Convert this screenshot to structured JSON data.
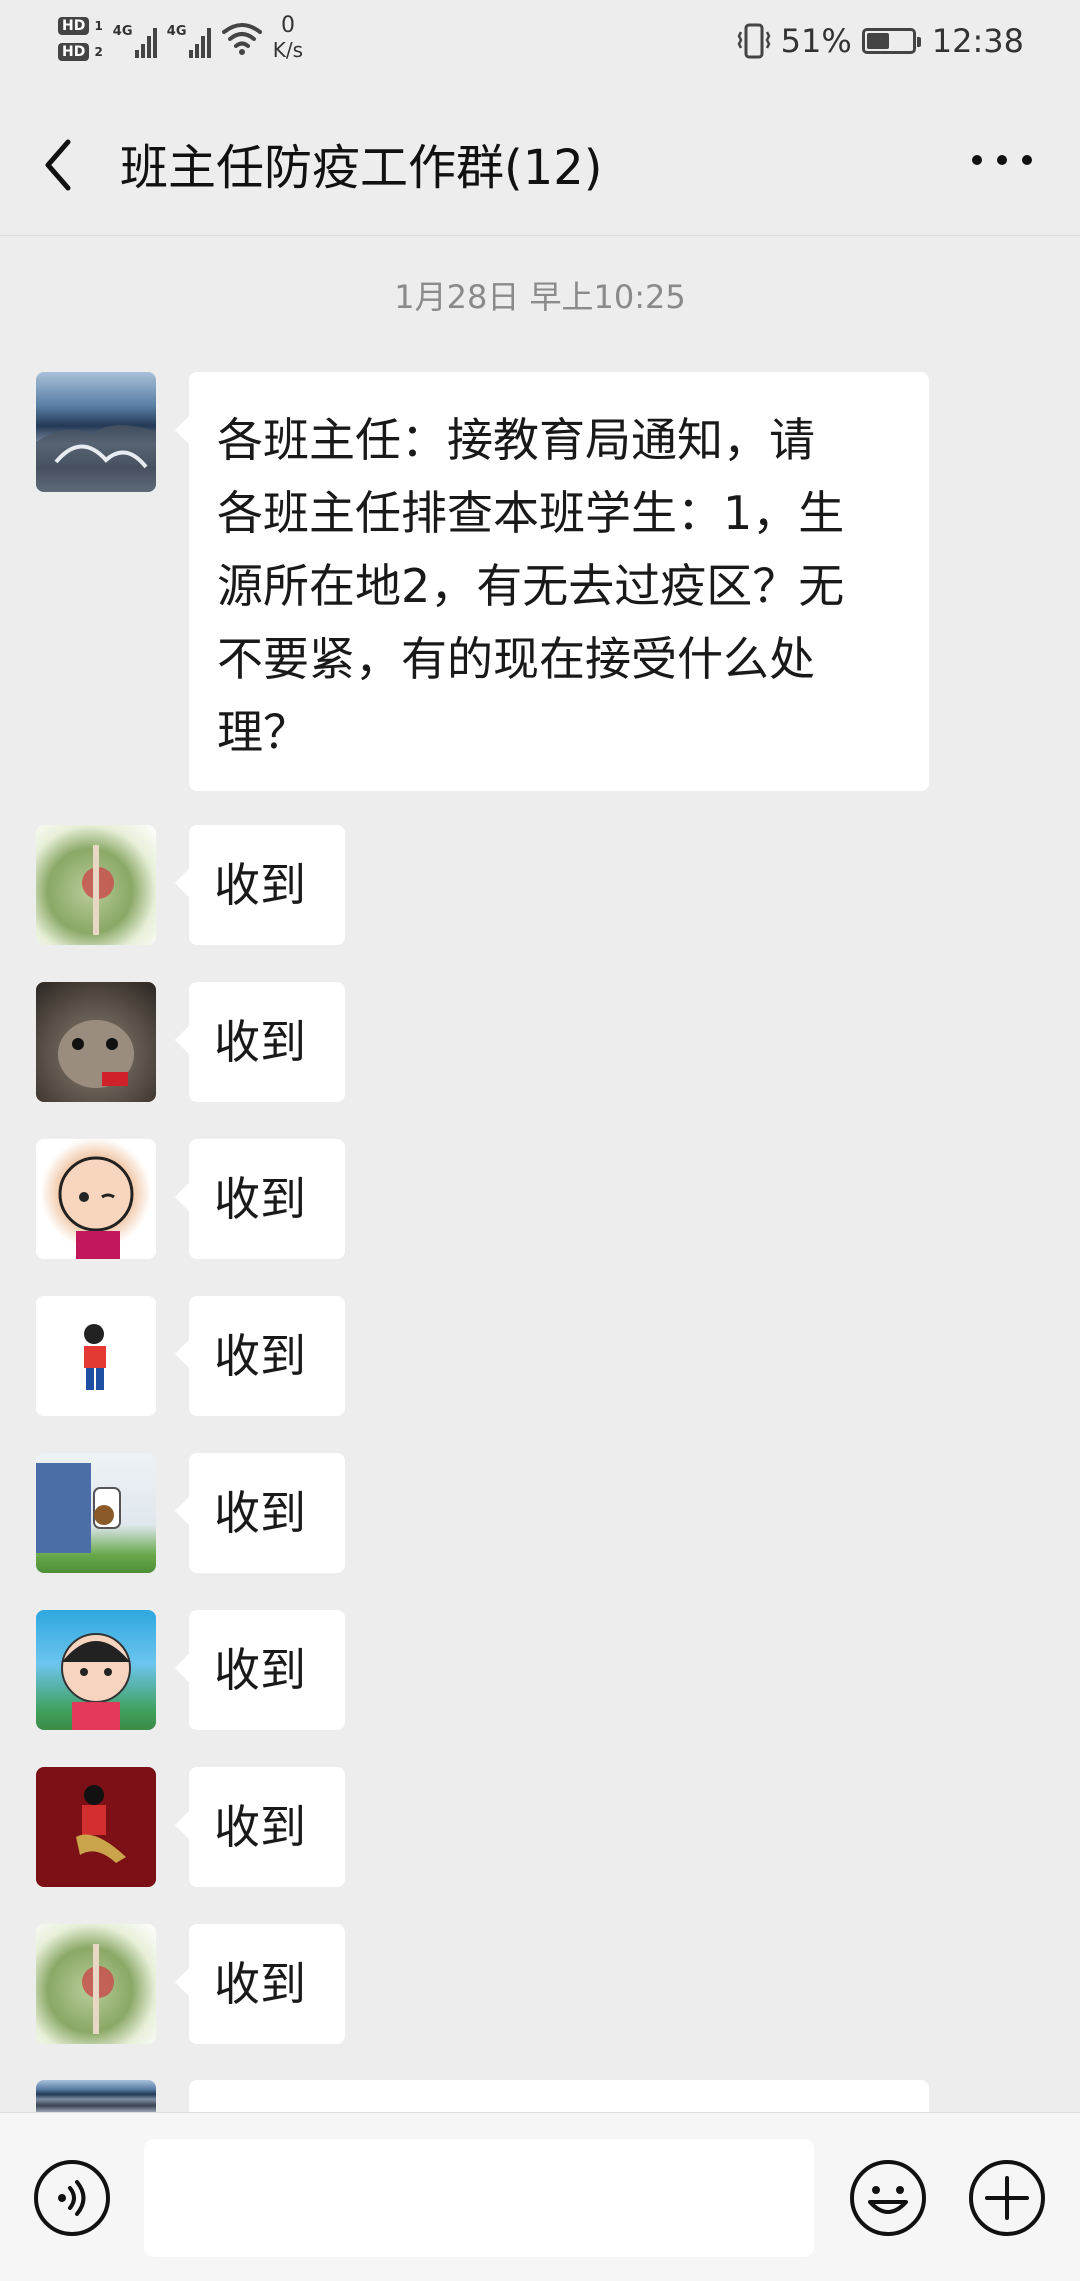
{
  "status_bar": {
    "sim1_label": "HD",
    "sim1_index": "1",
    "sim2_label": "HD",
    "sim2_index": "2",
    "network1": "4G",
    "network2": "4G",
    "speed_value": "0",
    "speed_unit": "K/s",
    "battery_percent": "51%",
    "battery_level": 0.51,
    "time": "12:38"
  },
  "header": {
    "title": "班主任防疫工作群(12)",
    "back_icon": "chevron-left-icon",
    "more_icon": "more-horizontal-icon"
  },
  "chat": {
    "timestamp": "1月28日 早上10:25",
    "messages": [
      {
        "avatar": "lake-avatar",
        "lines": [
          "各班主任：接教育局通知，请",
          "各班主任排查本班学生：1，生",
          "源所在地2，有无去过疫区？无",
          "不要紧，有的现在接受什么处",
          "理？"
        ]
      },
      {
        "avatar": "leaf-avatar",
        "text": "收到"
      },
      {
        "avatar": "cow-avatar",
        "text": "收到"
      },
      {
        "avatar": "baby-avatar",
        "text": "收到"
      },
      {
        "avatar": "girl-red-avatar",
        "text": "收到"
      },
      {
        "avatar": "man-blue-avatar",
        "text": "收到"
      },
      {
        "avatar": "face-avatar",
        "text": "收到"
      },
      {
        "avatar": "dancer-avatar",
        "text": "收到"
      },
      {
        "avatar": "leaf-avatar",
        "text": "收到"
      }
    ]
  },
  "input_bar": {
    "voice_icon": "voice-icon",
    "input_value": "",
    "input_placeholder": "",
    "emoji_icon": "emoji-icon",
    "plus_icon": "plus-circle-icon"
  }
}
